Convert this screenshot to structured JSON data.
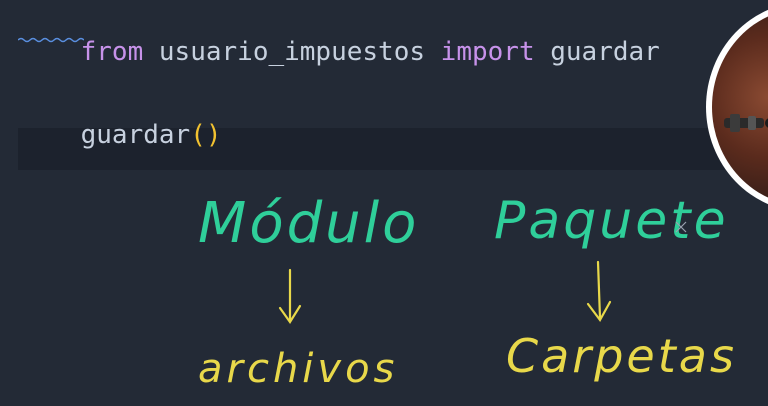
{
  "editor": {
    "line1": {
      "kw_from": "from",
      "module": " usuario_impuestos ",
      "kw_import": "import",
      "name": " guardar"
    },
    "line2": {
      "call": "guardar",
      "parens": "()"
    }
  },
  "annotations": {
    "left_label": "Módulo",
    "left_arrow_target": "archivos",
    "right_label": "Paquete",
    "right_arrow_target": "Carpetas",
    "colors": {
      "label_ink": "#2fcf9a",
      "target_ink": "#e8d84a"
    }
  },
  "webcam": {
    "icon": "presenter-webcam-icon"
  }
}
